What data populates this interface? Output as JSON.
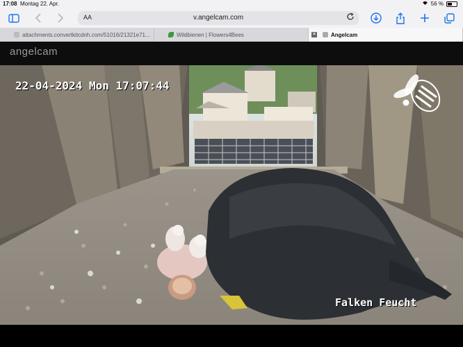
{
  "status_bar": {
    "time": "17:08",
    "date": "Montag 22. Apr.",
    "battery": "56 %"
  },
  "browser": {
    "aa_label": "AA",
    "url": "v.angelcam.com",
    "accent_color": "#1a73e8"
  },
  "tabs": [
    {
      "label": "attachments.convertkitcdnh.com/51016/21321e71...",
      "active": false
    },
    {
      "label": "Wildbienen | Flowers4Bees",
      "active": false
    },
    {
      "label": "Angelcam",
      "active": true
    }
  ],
  "page": {
    "brand": "angelcam"
  },
  "video": {
    "timestamp": "22-04-2024 Mon 17:07:44",
    "camera_name": "Falken Feucht"
  }
}
